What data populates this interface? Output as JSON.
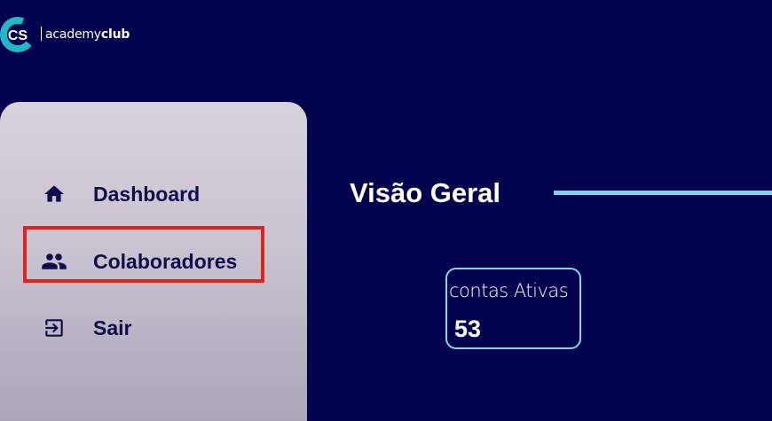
{
  "brand": {
    "logo_initials": "CS",
    "name_regular": "academy",
    "name_bold": "club"
  },
  "sidebar": {
    "items": [
      {
        "label": "Dashboard",
        "icon": "home-icon"
      },
      {
        "label": "Colaboradores",
        "icon": "people-icon",
        "highlighted": true
      },
      {
        "label": "Sair",
        "icon": "logout-icon"
      }
    ]
  },
  "main": {
    "title": "Visão Geral",
    "stat_card": {
      "label": "contas Ativas",
      "value": "53"
    }
  },
  "colors": {
    "background": "#02024e",
    "sidebar_text": "#0e0d4e",
    "accent_line": "#79d6ea",
    "card_border": "#86d6ef",
    "highlight_border": "#e1231e"
  }
}
